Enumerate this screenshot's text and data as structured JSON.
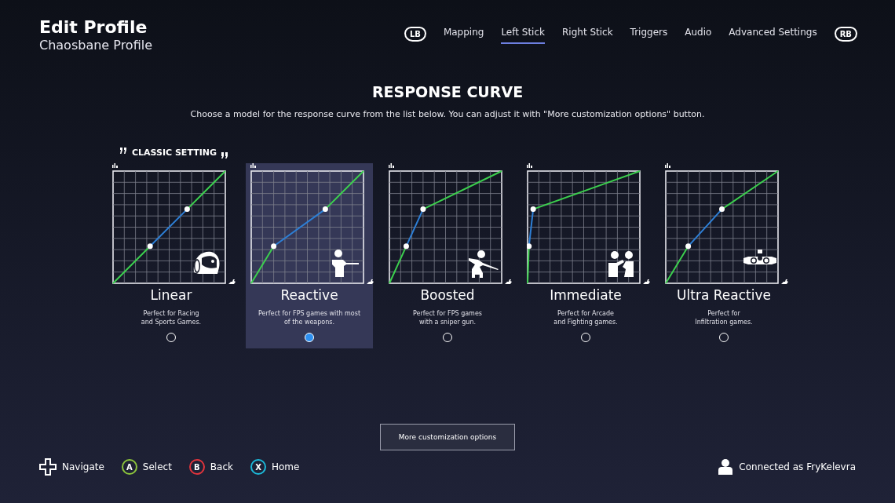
{
  "header": {
    "title": "Edit Profile",
    "subtitle": "Chaosbane Profile"
  },
  "tabs_nav": {
    "left_bumper": "LB",
    "right_bumper": "RB"
  },
  "tabs": [
    {
      "label": "Mapping",
      "selected": false
    },
    {
      "label": "Left Stick",
      "selected": true
    },
    {
      "label": "Right Stick",
      "selected": false
    },
    {
      "label": "Triggers",
      "selected": false
    },
    {
      "label": "Audio",
      "selected": false
    },
    {
      "label": "Advanced Settings",
      "selected": false
    }
  ],
  "section": {
    "title": "RESPONSE CURVE",
    "description": "Choose a model for the response curve from the list below. You can adjust it with \"More customization options\" button.",
    "classic_label": "CLASSIC SETTING"
  },
  "curves": [
    {
      "kind": "linear",
      "name": "Linear",
      "description": "Perfect for Racing\nand Sports Games.",
      "selected": false
    },
    {
      "kind": "reactive",
      "name": "Reactive",
      "description": "Perfect for FPS games with most\nof the weapons.",
      "selected": true
    },
    {
      "kind": "boosted",
      "name": "Boosted",
      "description": "Perfect for FPS games\nwith a sniper gun.",
      "selected": false
    },
    {
      "kind": "immediate",
      "name": "Immediate",
      "description": "Perfect for Arcade\nand Fighting games.",
      "selected": false
    },
    {
      "kind": "ultra",
      "name": "Ultra Reactive",
      "description": "Perfect for\nInfiltration games.",
      "selected": false
    }
  ],
  "more_button": "More customization options",
  "footer": {
    "hints": [
      {
        "kind": "dpad",
        "label": "Navigate"
      },
      {
        "kind": "button",
        "glyph": "A",
        "label": "Select",
        "color": "#8cc43c"
      },
      {
        "kind": "button",
        "glyph": "B",
        "label": "Back",
        "color": "#e0343c"
      },
      {
        "kind": "button",
        "glyph": "X",
        "label": "Home",
        "color": "#1cb8d8"
      }
    ],
    "account": "Connected as FryKelevra"
  }
}
